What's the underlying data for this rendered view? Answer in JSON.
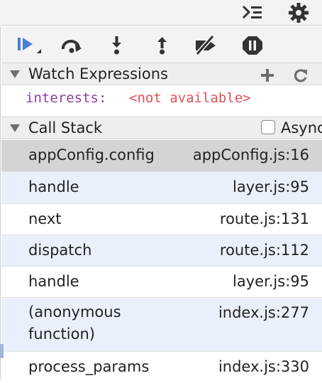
{
  "colors": {
    "accent": "#4a7fd6",
    "selected_frame_bg": "#d4d4d4",
    "alt_frame_bg": "#eaf0fb",
    "watch_name": "#8e3d9c",
    "watch_value": "#e0505a"
  },
  "topbar": {
    "icons": [
      "drawer-toggle-icon",
      "gear-icon"
    ]
  },
  "toolbar": {
    "buttons": [
      {
        "name": "resume-button",
        "icon": "resume-icon"
      },
      {
        "name": "step-over-button",
        "icon": "step-over-icon"
      },
      {
        "name": "step-into-button",
        "icon": "step-into-icon"
      },
      {
        "name": "step-out-button",
        "icon": "step-out-icon"
      },
      {
        "name": "deactivate-breakpoints-button",
        "icon": "breakpoints-off-icon"
      },
      {
        "name": "pause-on-exceptions-button",
        "icon": "pause-icon"
      }
    ]
  },
  "watch": {
    "title": "Watch Expressions",
    "add_icon": "plus-icon",
    "refresh_icon": "refresh-icon",
    "entries": [
      {
        "name": "interests:",
        "value": "<not available>"
      }
    ]
  },
  "callstack": {
    "title": "Call Stack",
    "async_label": "Async",
    "async_checked": false,
    "frames": [
      {
        "name": "appConfig.config",
        "location": "appConfig.js:16",
        "selected": true
      },
      {
        "name": "handle",
        "location": "layer.js:95"
      },
      {
        "name": "next",
        "location": "route.js:131"
      },
      {
        "name": "dispatch",
        "location": "route.js:112"
      },
      {
        "name": "handle",
        "location": "layer.js:95"
      },
      {
        "name": "(anonymous function)",
        "location": "index.js:277"
      },
      {
        "name": "process_params",
        "location": "index.js:330"
      }
    ]
  }
}
